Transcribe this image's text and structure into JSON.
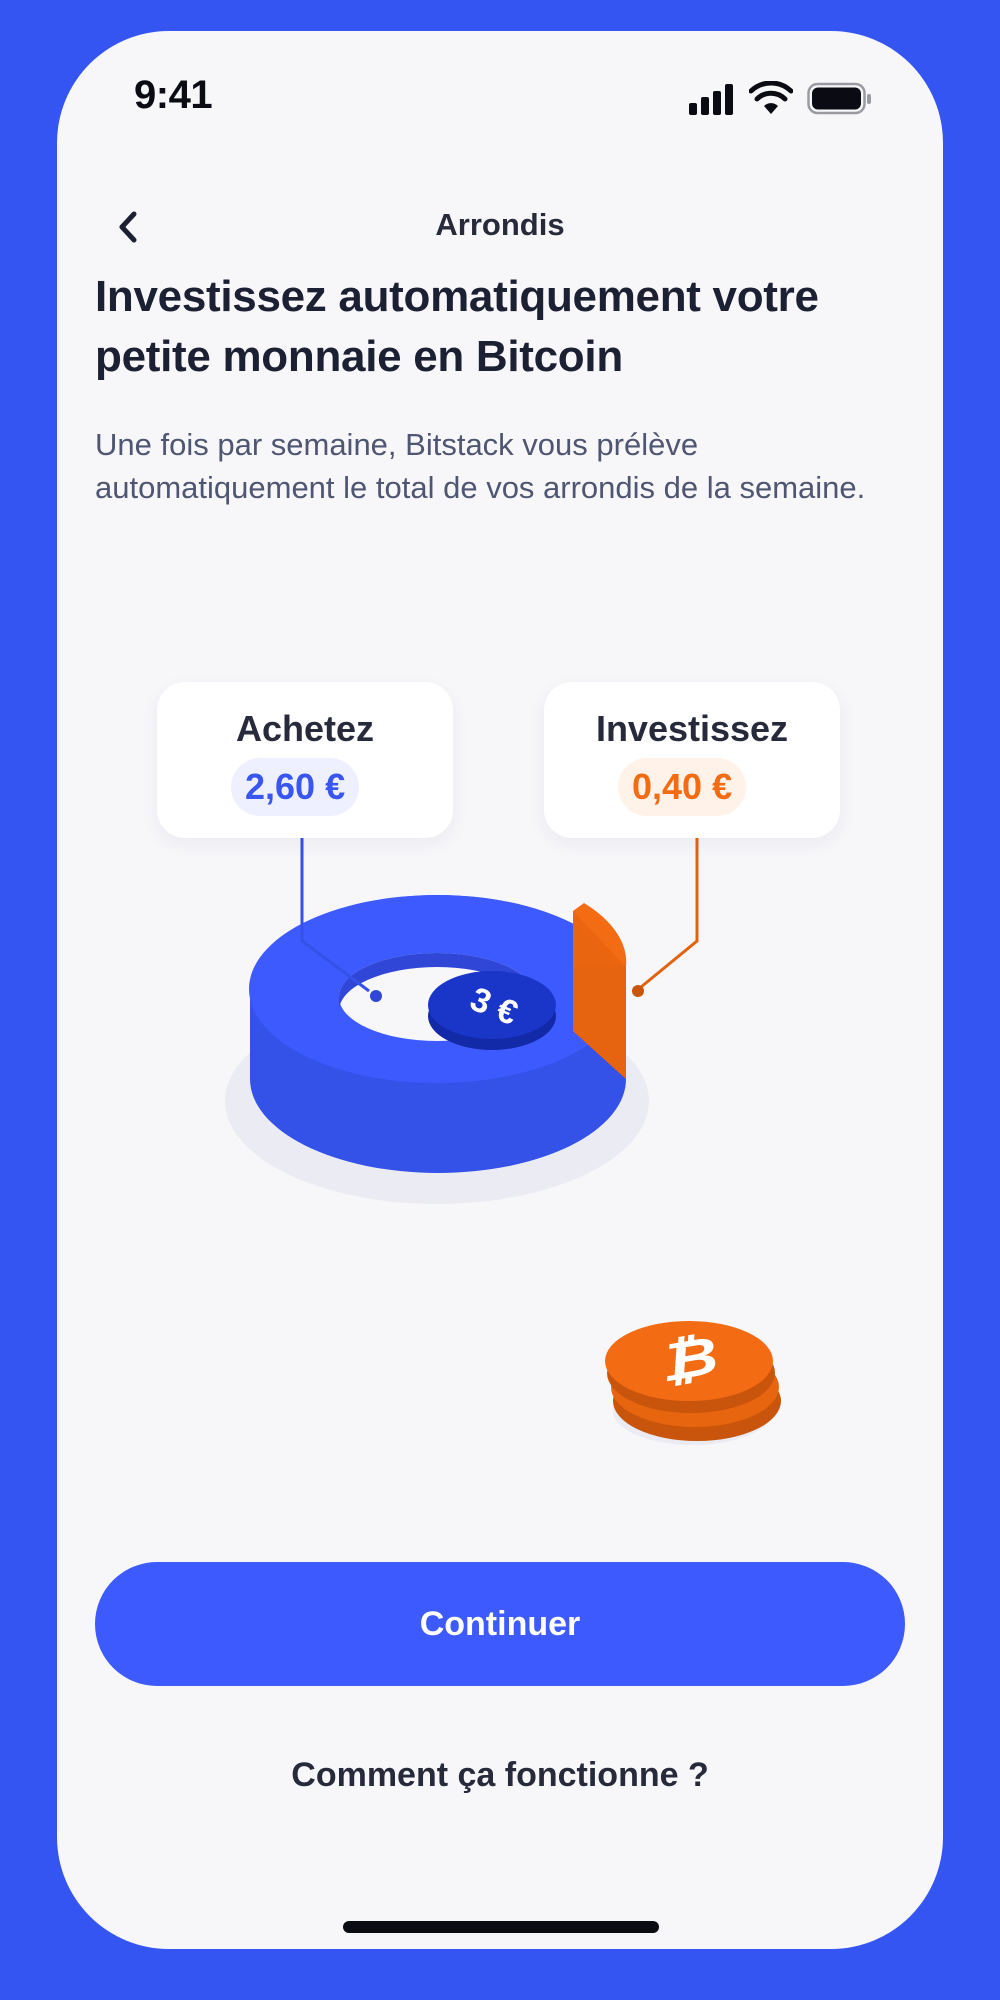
{
  "status_bar": {
    "time": "9:41"
  },
  "nav": {
    "title": "Arrondis",
    "back_icon": "chevron-left-icon"
  },
  "headline": "Investissez automatiquement votre petite monnaie en Bitcoin",
  "description": "Une fois par semaine, Bitstack vous prélève automatiquement le total de vos arrondis de la semaine.",
  "illustration": {
    "buy": {
      "label": "Achetez",
      "amount": "2,60 €"
    },
    "invest": {
      "label": "Investissez",
      "amount": "0,40 €"
    },
    "total_coin": "3 €",
    "coin_icon": "bitcoin-icon"
  },
  "colors": {
    "brand_blue": "#3d5afe",
    "dark_blue": "#1a36c8",
    "orange": "#f36c14",
    "background": "#3555f2"
  },
  "actions": {
    "continue_label": "Continuer",
    "help_label": "Comment ça fonctionne ?"
  }
}
